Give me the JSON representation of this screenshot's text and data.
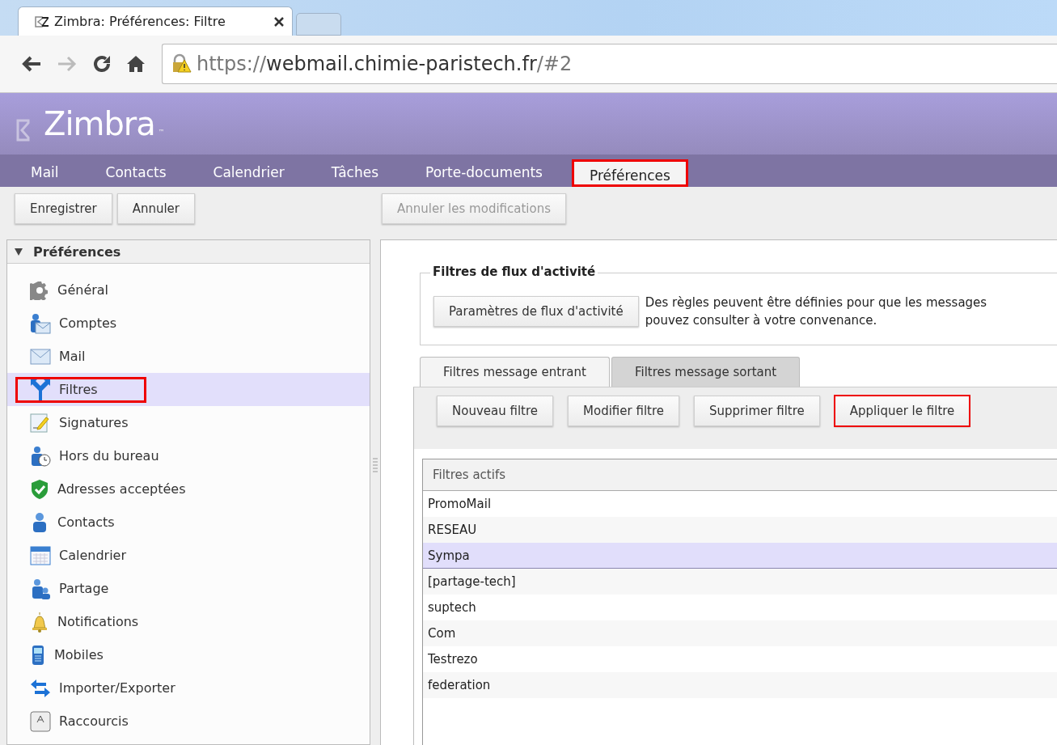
{
  "browser": {
    "tab_title": "Zimbra: Préférences: Filtre",
    "url": {
      "scheme": "https://",
      "host": "webmail.chimie-paristech.fr",
      "path": "/#2"
    },
    "forward_disabled": true
  },
  "app": {
    "logo": "Zimbra",
    "logo_mark": "™"
  },
  "app_tabs": [
    {
      "label": "Mail",
      "selected": false,
      "highlighted": false
    },
    {
      "label": "Contacts",
      "selected": false,
      "highlighted": false
    },
    {
      "label": "Calendrier",
      "selected": false,
      "highlighted": false
    },
    {
      "label": "Tâches",
      "selected": false,
      "highlighted": false
    },
    {
      "label": "Porte-documents",
      "selected": false,
      "highlighted": false
    },
    {
      "label": "Préférences",
      "selected": true,
      "highlighted": true
    }
  ],
  "toolbar": {
    "buttons": [
      {
        "label": "Enregistrer",
        "disabled": false
      },
      {
        "label": "Annuler",
        "disabled": false
      }
    ],
    "undo_button": {
      "label": "Annuler les modifications",
      "disabled": true
    }
  },
  "sidebar": {
    "header": "Préférences",
    "expanded": true,
    "items": [
      {
        "label": "Général",
        "selected": false,
        "highlighted": false
      },
      {
        "label": "Comptes",
        "selected": false,
        "highlighted": false
      },
      {
        "label": "Mail",
        "selected": false,
        "highlighted": false
      },
      {
        "label": "Filtres",
        "selected": true,
        "highlighted": true
      },
      {
        "label": "Signatures",
        "selected": false,
        "highlighted": false
      },
      {
        "label": "Hors du bureau",
        "selected": false,
        "highlighted": false
      },
      {
        "label": "Adresses acceptées",
        "selected": false,
        "highlighted": false
      },
      {
        "label": "Contacts",
        "selected": false,
        "highlighted": false
      },
      {
        "label": "Calendrier",
        "selected": false,
        "highlighted": false
      },
      {
        "label": "Partage",
        "selected": false,
        "highlighted": false
      },
      {
        "label": "Notifications",
        "selected": false,
        "highlighted": false
      },
      {
        "label": "Mobiles",
        "selected": false,
        "highlighted": false
      },
      {
        "label": "Importer/Exporter",
        "selected": false,
        "highlighted": false
      },
      {
        "label": "Raccourcis",
        "selected": false,
        "highlighted": false
      }
    ]
  },
  "activity": {
    "legend": "Filtres de flux d'activité",
    "button": "Paramètres de flux d'activité",
    "description": [
      "Des règles peuvent être définies pour que les messages",
      "pouvez consulter à votre convenance."
    ]
  },
  "filter_tabs": [
    {
      "label": "Filtres message entrant",
      "selected": true
    },
    {
      "label": "Filtres message sortant",
      "selected": false
    }
  ],
  "filter_buttons": [
    {
      "label": "Nouveau filtre",
      "highlighted": false
    },
    {
      "label": "Modifier filtre",
      "highlighted": false
    },
    {
      "label": "Supprimer filtre",
      "highlighted": false
    },
    {
      "label": "Appliquer le filtre",
      "highlighted": true
    }
  ],
  "filters": {
    "header": "Filtres actifs",
    "rows": [
      {
        "name": "PromoMail",
        "selected": false
      },
      {
        "name": "RESEAU",
        "selected": false
      },
      {
        "name": "Sympa",
        "selected": true
      },
      {
        "name": "[partage-tech]",
        "selected": false
      },
      {
        "name": "suptech",
        "selected": false
      },
      {
        "name": "Com",
        "selected": false
      },
      {
        "name": "Testrezo",
        "selected": false
      },
      {
        "name": "federation",
        "selected": false
      }
    ]
  }
}
